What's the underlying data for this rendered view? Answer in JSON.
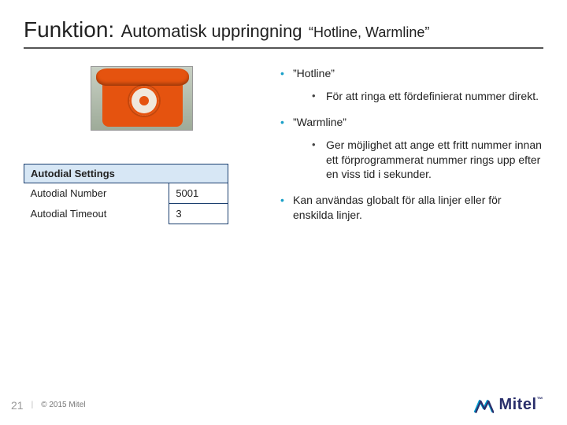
{
  "title": {
    "main": "Funktion:",
    "sub1": "Automatisk uppringning",
    "sub2": "“Hotline, Warmline”"
  },
  "settings": {
    "header": "Autodial Settings",
    "rows": [
      {
        "label": "Autodial Number",
        "value": "5001"
      },
      {
        "label": "Autodial Timeout",
        "value": "3"
      }
    ]
  },
  "bullets": [
    {
      "text": "”Hotline”",
      "children": [
        {
          "text": "För att ringa ett fördefinierat nummer direkt."
        }
      ]
    },
    {
      "text": "”Warmline”",
      "children": [
        {
          "text": "Ger möjlighet att ange ett fritt nummer innan ett förprogrammerat nummer rings upp efter en viss tid i sekunder."
        }
      ]
    },
    {
      "text": "Kan användas globalt för alla linjer eller för enskilda linjer.",
      "children": []
    }
  ],
  "footer": {
    "page": "21",
    "separator": "|",
    "copyright": "© 2015 Mitel",
    "brand": "Mitel"
  }
}
